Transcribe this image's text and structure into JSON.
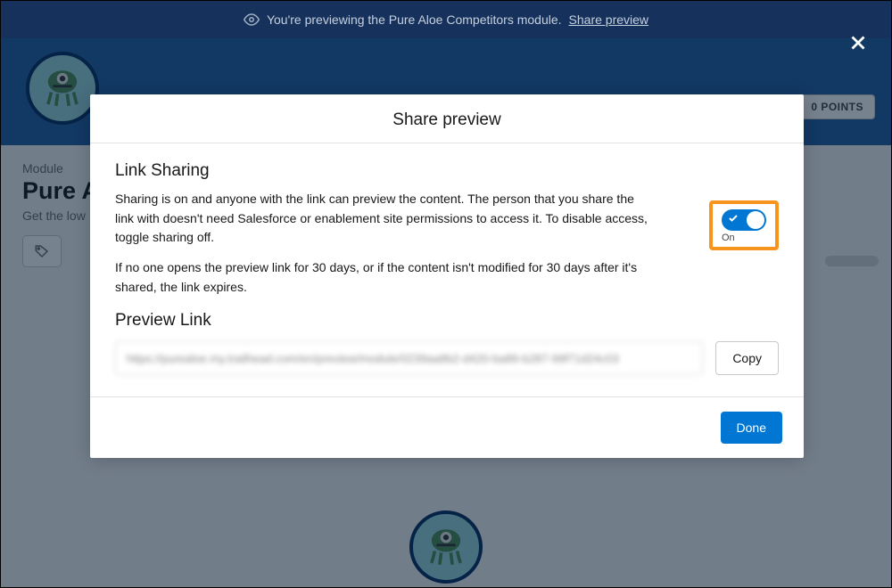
{
  "banner": {
    "text": "You're previewing the Pure Aloe Competitors module.",
    "link": "Share preview"
  },
  "header": {
    "points": "0 POINTS"
  },
  "page": {
    "module_label": "Module",
    "title": "Pure Aloe Competitors",
    "subtitle": "Get the low"
  },
  "modal": {
    "title": "Share preview",
    "section_title": "Link Sharing",
    "paragraph1": "Sharing is on and anyone with the link can preview the content. The person that you share the link with doesn't need Salesforce or enablement site permissions to access it. To disable access, toggle sharing off.",
    "paragraph2": "If no one opens the preview link for 30 days, or if the content isn't modified for 30 days after it's shared, the link expires.",
    "toggle_label": "On",
    "preview_link_title": "Preview Link",
    "link_value": "https://purealoe.my.trailhead.com/en/preview/module/0239aa8b2-d420-ba89-b287-99f71d24c03",
    "copy": "Copy",
    "done": "Done"
  }
}
